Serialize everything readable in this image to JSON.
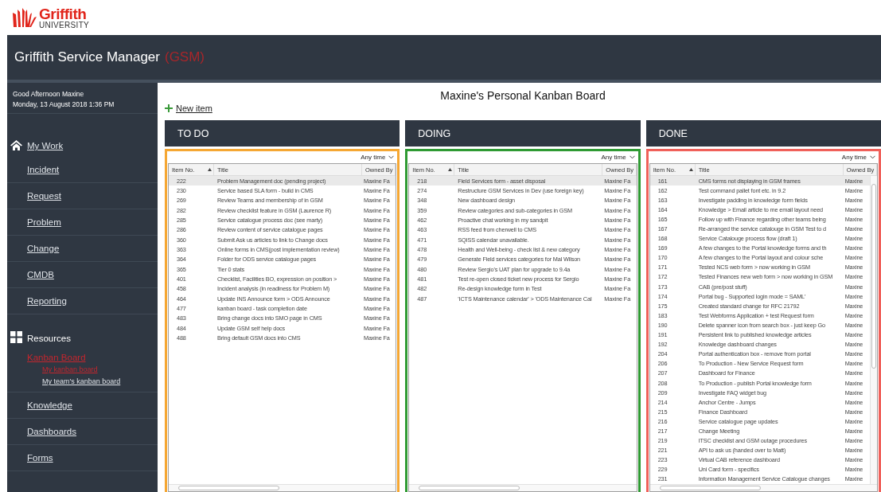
{
  "logo": {
    "name": "Griffith",
    "subtitle": "UNIVERSITY"
  },
  "header": {
    "title": "Griffith Service Manager",
    "badge": "(GSM)"
  },
  "sidebar": {
    "greeting": "Good Afternoon Maxine",
    "date": "Monday, 13 August 2018 1:36 PM",
    "items": [
      {
        "kind": "home",
        "label": "My Work",
        "selected": false
      },
      {
        "kind": "link",
        "label": "Incident",
        "selected": false
      },
      {
        "kind": "link",
        "label": "Request",
        "selected": false
      },
      {
        "kind": "link",
        "label": "Problem",
        "selected": false
      },
      {
        "kind": "link",
        "label": "Change",
        "selected": false
      },
      {
        "kind": "link",
        "label": "CMDB",
        "selected": false
      },
      {
        "kind": "link",
        "label": "Reporting",
        "selected": false
      },
      {
        "kind": "section",
        "label": "Resources"
      },
      {
        "kind": "link",
        "label": "Kanban Board",
        "selected": true,
        "children": [
          {
            "label": "My kanban board",
            "selected": true
          },
          {
            "label": "My team's kanban board",
            "selected": false
          }
        ]
      },
      {
        "kind": "link",
        "label": "Knowledge",
        "selected": false
      },
      {
        "kind": "link",
        "label": "Dashboards",
        "selected": false
      },
      {
        "kind": "link",
        "label": "Forms",
        "selected": false
      }
    ]
  },
  "board": {
    "title": "Maxine's Personal Kanban Board",
    "new_item": "New item",
    "columns": [
      {
        "name": "TO DO",
        "color": "#f5a733",
        "filter": "Any time",
        "headers": [
          "Item No.",
          "Title",
          "Owned By"
        ],
        "rows": [
          {
            "no": "222",
            "title": "Problem Management doc (pending project)",
            "owner": "Maxine Fa",
            "selected": true
          },
          {
            "no": "230",
            "title": "Service based SLA form - build in CMS",
            "owner": "Maxine Fa",
            "selected": false
          },
          {
            "no": "269",
            "title": "Review Teams and membership of in GSM",
            "owner": "Maxine Fa",
            "selected": false
          },
          {
            "no": "282",
            "title": "Review checklist feature in GSM (Laurence R)",
            "owner": "Maxine Fa",
            "selected": false
          },
          {
            "no": "285",
            "title": "Service catalogue process doc (see marty)",
            "owner": "Maxine Fa",
            "selected": false
          },
          {
            "no": "286",
            "title": "Review content of service catalogue pages",
            "owner": "Maxine Fa",
            "selected": false
          },
          {
            "no": "360",
            "title": "Submit Ask us articles to link to Change docs",
            "owner": "Maxine Fa",
            "selected": false
          },
          {
            "no": "363",
            "title": "Online forms in CMS(post implementation review)",
            "owner": "Maxine Fa",
            "selected": false
          },
          {
            "no": "364",
            "title": "Folder for ODS service catalogue pages",
            "owner": "Maxine Fa",
            "selected": false
          },
          {
            "no": "365",
            "title": "Tier 0 stats",
            "owner": "Maxine Fa",
            "selected": false
          },
          {
            "no": "401",
            "title": "Checklist, Facilities BO, expression on position >",
            "owner": "Maxine Fa",
            "selected": false
          },
          {
            "no": "458",
            "title": "Incident analysis (in readiness for Problem M)",
            "owner": "Maxine Fa",
            "selected": false
          },
          {
            "no": "464",
            "title": "Update INS Announce form > ODS Announce",
            "owner": "Maxine Fa",
            "selected": false
          },
          {
            "no": "477",
            "title": "kanban board - task completion date",
            "owner": "Maxine Fa",
            "selected": false
          },
          {
            "no": "483",
            "title": "Bring change docs into SMO page in CMS",
            "owner": "Maxine Fa",
            "selected": false
          },
          {
            "no": "484",
            "title": "Update GSM self help docs",
            "owner": "Maxine Fa",
            "selected": false
          },
          {
            "no": "488",
            "title": "Bring default GSM docs into CMS",
            "owner": "Maxine Fa",
            "selected": false
          }
        ]
      },
      {
        "name": "DOING",
        "color": "#2f9a33",
        "filter": "Any time",
        "headers": [
          "Item No.",
          "Title",
          "Owned By"
        ],
        "rows": [
          {
            "no": "218",
            "title": "Field Services form - asset disposal",
            "owner": "Maxine Fa",
            "selected": true
          },
          {
            "no": "274",
            "title": "Restructure GSM Services in Dev (use foreign key)",
            "owner": "Maxine Fa",
            "selected": false
          },
          {
            "no": "348",
            "title": "New dashboard design",
            "owner": "Maxine Fa",
            "selected": false
          },
          {
            "no": "359",
            "title": "Review categories and sub-categories in GSM",
            "owner": "Maxine Fa",
            "selected": false
          },
          {
            "no": "462",
            "title": "Proactive chat working in my sandpit",
            "owner": "Maxine Fa",
            "selected": false
          },
          {
            "no": "463",
            "title": "RSS feed from cherwell to CMS",
            "owner": "Maxine Fa",
            "selected": false
          },
          {
            "no": "471",
            "title": "SQISS calendar unavailable.",
            "owner": "Maxine Fa",
            "selected": false
          },
          {
            "no": "478",
            "title": "Health and Well-being - check list & new category",
            "owner": "Maxine Fa",
            "selected": false
          },
          {
            "no": "479",
            "title": "Generate Field services categories for Mal Wilson",
            "owner": "Maxine Fa",
            "selected": false
          },
          {
            "no": "480",
            "title": "Review Sergio's UAT plan for upgrade to 9.4a",
            "owner": "Maxine Fa",
            "selected": false
          },
          {
            "no": "481",
            "title": "Test re-open closed ticket new process for Sergio",
            "owner": "Maxine Fa",
            "selected": false
          },
          {
            "no": "482",
            "title": "Re-design knowledge form in Test",
            "owner": "Maxine Fa",
            "selected": false
          },
          {
            "no": "487",
            "title": "'ICTS Maintenance calendar' > 'ODS Maintenance Cal",
            "owner": "Maxine Fa",
            "selected": false
          }
        ]
      },
      {
        "name": "DONE",
        "color": "#f0605a",
        "filter": "Any time",
        "headers": [
          "Item No.",
          "Title",
          "Owned By"
        ],
        "rows": [
          {
            "no": "161",
            "title": "CMS forms not displaying in GSM frames",
            "owner": "Maxine",
            "selected": true
          },
          {
            "no": "162",
            "title": "Test command pallet font etc. in 9.2",
            "owner": "Maxine",
            "selected": false
          },
          {
            "no": "163",
            "title": "Investigate padding in knowledge form fields",
            "owner": "Maxine",
            "selected": false
          },
          {
            "no": "164",
            "title": "Knowledge > Email article to me email layout need",
            "owner": "Maxine",
            "selected": false
          },
          {
            "no": "165",
            "title": "Follow up with Finance regarding other teams being",
            "owner": "Maxine",
            "selected": false
          },
          {
            "no": "167",
            "title": "Re-arranged the service catalouge in GSM Test to d",
            "owner": "Maxine",
            "selected": false
          },
          {
            "no": "168",
            "title": "Service Catalouge process flow (draft 1)",
            "owner": "Maxine",
            "selected": false
          },
          {
            "no": "169",
            "title": "A few changes to the Portal knowledge forms and th",
            "owner": "Maxine",
            "selected": false
          },
          {
            "no": "170",
            "title": "A few changes to the Portal layout and colour sche",
            "owner": "Maxine",
            "selected": false
          },
          {
            "no": "171",
            "title": "Tested NCS web form > now working in GSM",
            "owner": "Maxine",
            "selected": false
          },
          {
            "no": "172",
            "title": "Tested Finances new web form > now working in GSM",
            "owner": "Maxine",
            "selected": false
          },
          {
            "no": "173",
            "title": "CAB (pre/post stuff)",
            "owner": "Maxine",
            "selected": false
          },
          {
            "no": "174",
            "title": "Portal bug - Supported login mode = SAML'",
            "owner": "Maxine",
            "selected": false
          },
          {
            "no": "175",
            "title": "Created standard change for RFC 21792",
            "owner": "Maxine",
            "selected": false
          },
          {
            "no": "183",
            "title": "Test Webforms Application + test Request form",
            "owner": "Maxine",
            "selected": false
          },
          {
            "no": "190",
            "title": "Delete spanner icon from search box - just keep Go",
            "owner": "Maxine",
            "selected": false
          },
          {
            "no": "191",
            "title": "Persistent link to published knowledge articles",
            "owner": "Maxine",
            "selected": false
          },
          {
            "no": "192",
            "title": "Knowledge dashboard changes",
            "owner": "Maxine",
            "selected": false
          },
          {
            "no": "204",
            "title": "Portal authentication box - remove from portal",
            "owner": "Maxine",
            "selected": false
          },
          {
            "no": "206",
            "title": "To Production - New Service Request form",
            "owner": "Maxine",
            "selected": false
          },
          {
            "no": "207",
            "title": "Dashboard for Finance",
            "owner": "Maxine",
            "selected": false
          },
          {
            "no": "208",
            "title": "To Production - publish Portal knowledge form",
            "owner": "Maxine",
            "selected": false
          },
          {
            "no": "209",
            "title": "Investigate FAQ widget bug",
            "owner": "Maxine",
            "selected": false
          },
          {
            "no": "214",
            "title": "Anchor Centre - Jumps",
            "owner": "Maxine",
            "selected": false
          },
          {
            "no": "215",
            "title": "Finance Dashboard",
            "owner": "Maxine",
            "selected": false
          },
          {
            "no": "216",
            "title": "Service catalogue page updates",
            "owner": "Maxine",
            "selected": false
          },
          {
            "no": "217",
            "title": "Change Meeting",
            "owner": "Maxine",
            "selected": false
          },
          {
            "no": "219",
            "title": "ITSC checklist and GSM outage procedures",
            "owner": "Maxine",
            "selected": false
          },
          {
            "no": "221",
            "title": "API to ask us (handed over to Matt)",
            "owner": "Maxine",
            "selected": false
          },
          {
            "no": "223",
            "title": "Virtual CAB reference dashboard",
            "owner": "Maxine",
            "selected": false
          },
          {
            "no": "229",
            "title": "Uni Card form - specifics",
            "owner": "Maxine",
            "selected": false
          },
          {
            "no": "231",
            "title": "Information Management Service Catalogue changes",
            "owner": "Maxine",
            "selected": false
          }
        ]
      }
    ]
  }
}
